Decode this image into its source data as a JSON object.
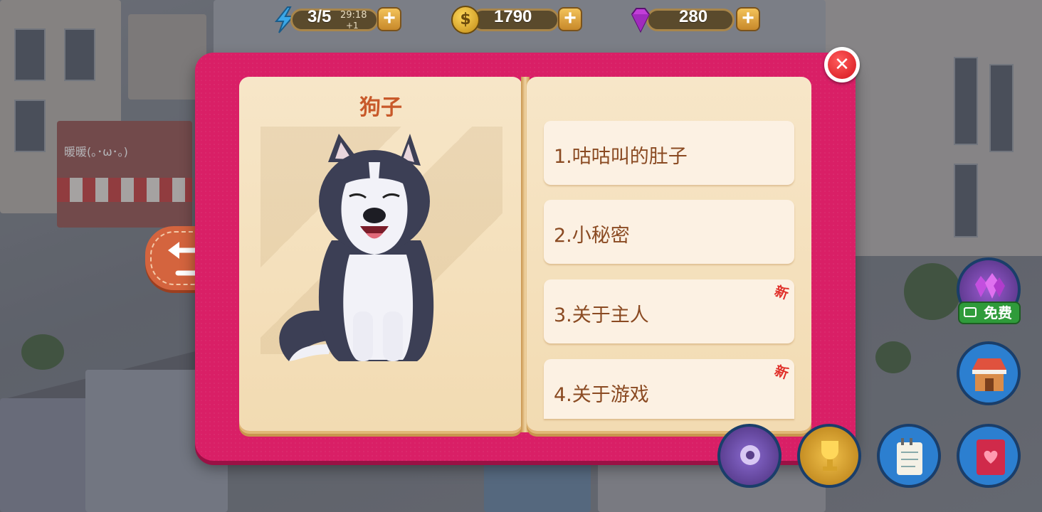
{
  "hud": {
    "energy": {
      "value": "3/5",
      "timer": "29:18",
      "regen": "+1",
      "icon": "lightning-icon"
    },
    "coins": {
      "value": "1790",
      "icon": "coin-icon"
    },
    "gems": {
      "value": "280",
      "icon": "gem-icon"
    },
    "plus_label": "+"
  },
  "background": {
    "shop_sign": "暖暖(｡･ω･｡)"
  },
  "book": {
    "pet_name": "狗子",
    "pet_image": "husky-dog-image",
    "stories": [
      {
        "label": "1.咕咕叫的肚子",
        "new": false
      },
      {
        "label": "2.小秘密",
        "new": false
      },
      {
        "label": "3.关于主人",
        "new": true
      },
      {
        "label": "4.关于游戏",
        "new": true
      }
    ],
    "new_badge": "新",
    "close_icon": "✕"
  },
  "side": {
    "free_label": "免费"
  },
  "colors": {
    "book_cover": "#d91f66",
    "page": "#f7e6c8",
    "title": "#c8592a",
    "item_text": "#8a4a22",
    "new_badge": "#e0302a"
  }
}
